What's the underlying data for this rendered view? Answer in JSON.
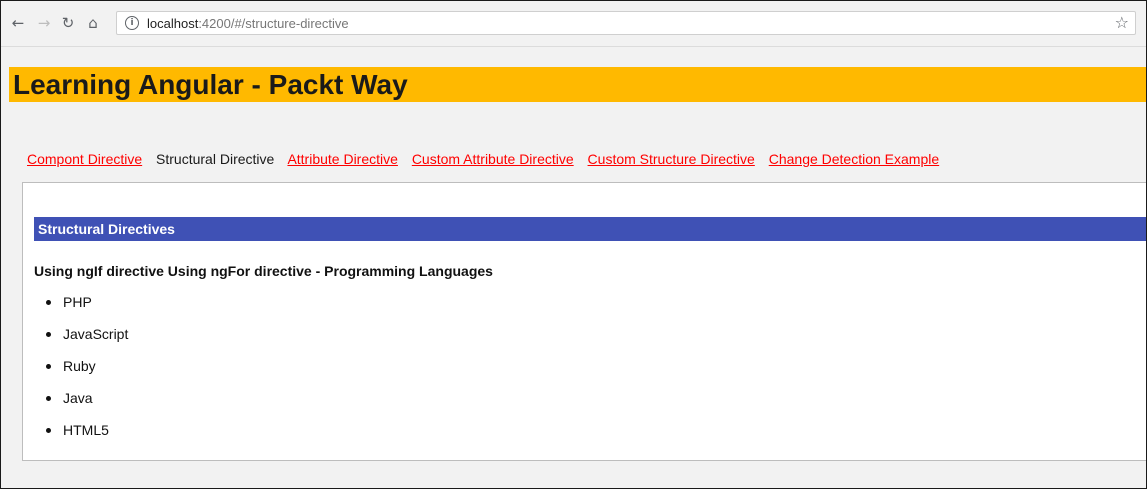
{
  "browser": {
    "url_host": "localhost",
    "url_rest": ":4200/#/structure-directive",
    "icons": {
      "back": "back-arrow-icon",
      "forward": "forward-arrow-icon",
      "reload": "reload-icon",
      "home": "home-icon",
      "info": "info-icon",
      "bookmark": "star-icon"
    }
  },
  "header": {
    "title": "Learning Angular - Packt Way",
    "background": "#ffb900"
  },
  "nav": {
    "links": [
      {
        "label": "Compont Directive",
        "active": false
      },
      {
        "label": "Structural Directive",
        "active": true
      },
      {
        "label": "Attribute Directive",
        "active": false
      },
      {
        "label": "Custom Attribute Directive",
        "active": false
      },
      {
        "label": "Custom Structure Directive",
        "active": false
      },
      {
        "label": "Change Detection Example",
        "active": false
      }
    ],
    "link_color": "#ff0000"
  },
  "content": {
    "section_title": "Structural Directives",
    "section_color": "#3f51b5",
    "subheading": "Using ngIf directive Using ngFor directive - Programming Languages",
    "languages": [
      "PHP",
      "JavaScript",
      "Ruby",
      "Java",
      "HTML5"
    ]
  }
}
